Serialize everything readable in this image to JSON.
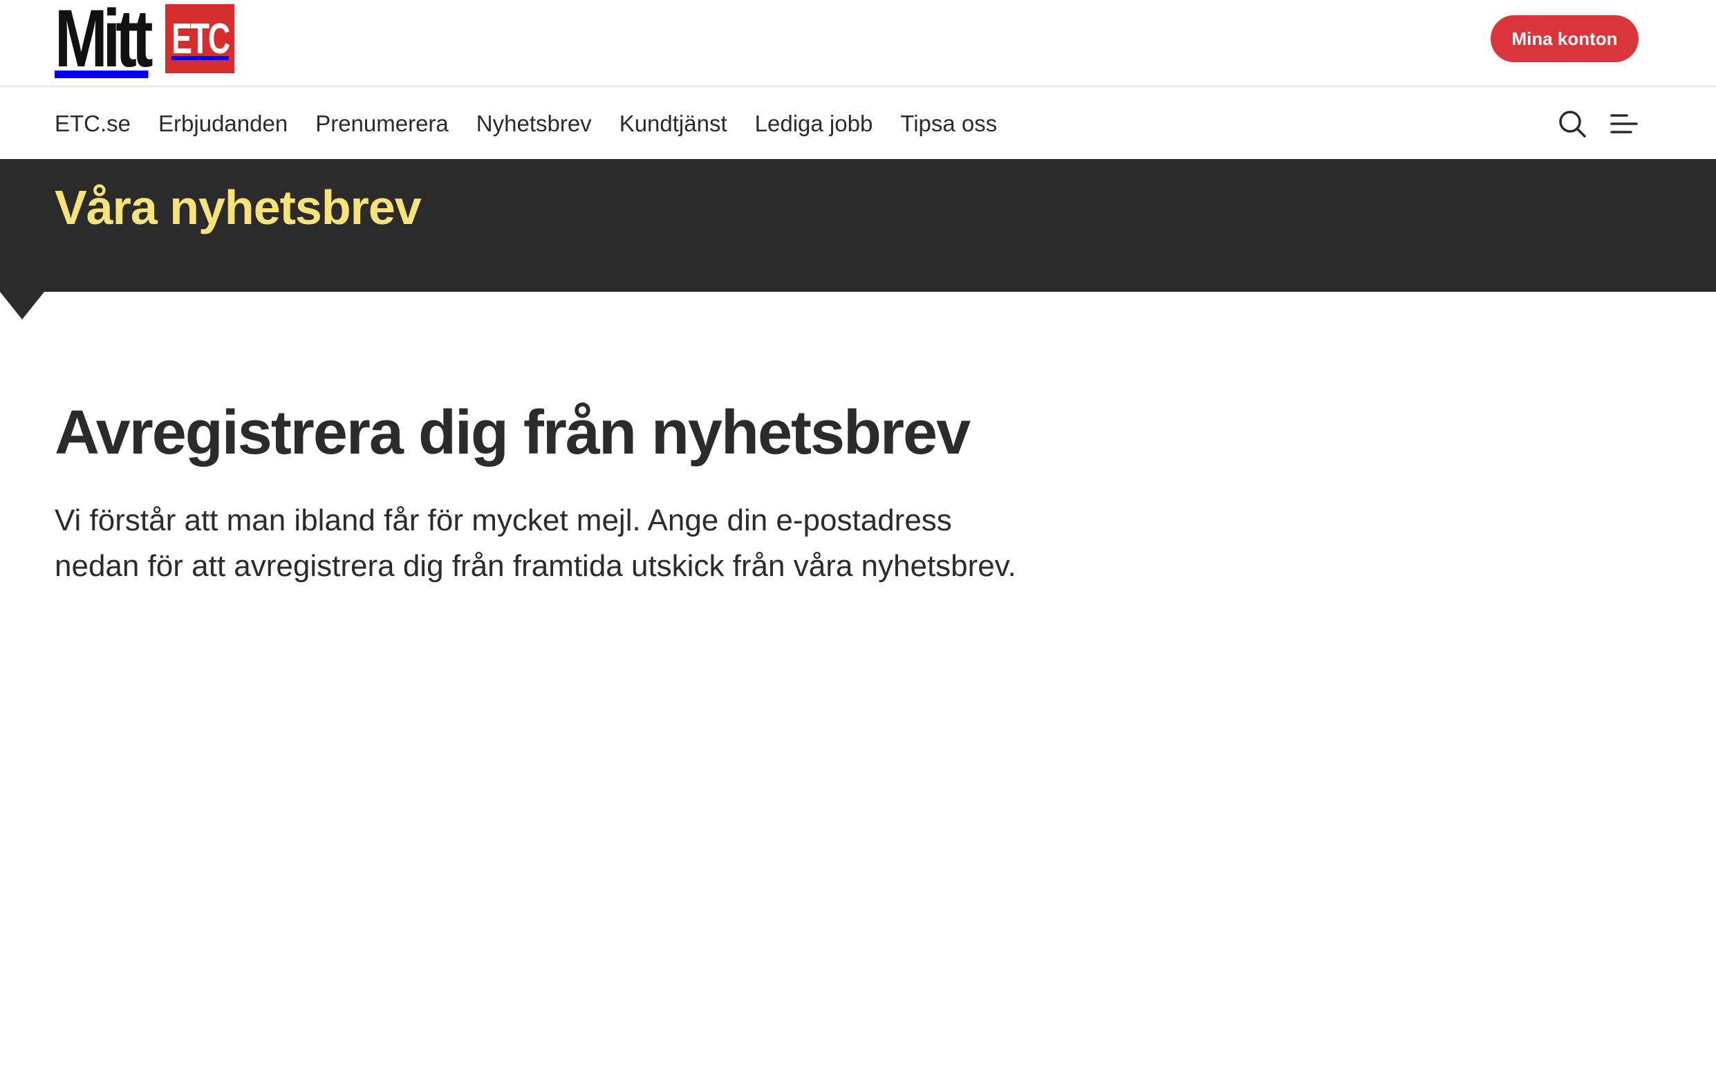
{
  "header": {
    "logo_text": "Mitt",
    "logo_badge": "ETC",
    "account_button": "Mina konton"
  },
  "nav": {
    "items": [
      {
        "label": "ETC.se"
      },
      {
        "label": "Erbjudanden"
      },
      {
        "label": "Prenumerera"
      },
      {
        "label": "Nyhetsbrev"
      },
      {
        "label": "Kundtjänst"
      },
      {
        "label": "Lediga jobb"
      },
      {
        "label": "Tipsa oss"
      }
    ],
    "icons": {
      "search": "search-icon",
      "menu": "menu-icon"
    }
  },
  "banner": {
    "title": "Våra nyhetsbrev"
  },
  "main": {
    "heading": "Avregistrera dig från nyhetsbrev",
    "intro": "Vi förstår att man ibland får för mycket mejl. Ange din e-postadress nedan för att avregistrera dig från framtida utskick från våra nyhetsbrev."
  },
  "colors": {
    "brand_red": "#d62e2e",
    "button_red": "#d9353b",
    "banner_bg": "#2b2b2b",
    "banner_title": "#f8e27a",
    "text": "#2b2b2b"
  }
}
